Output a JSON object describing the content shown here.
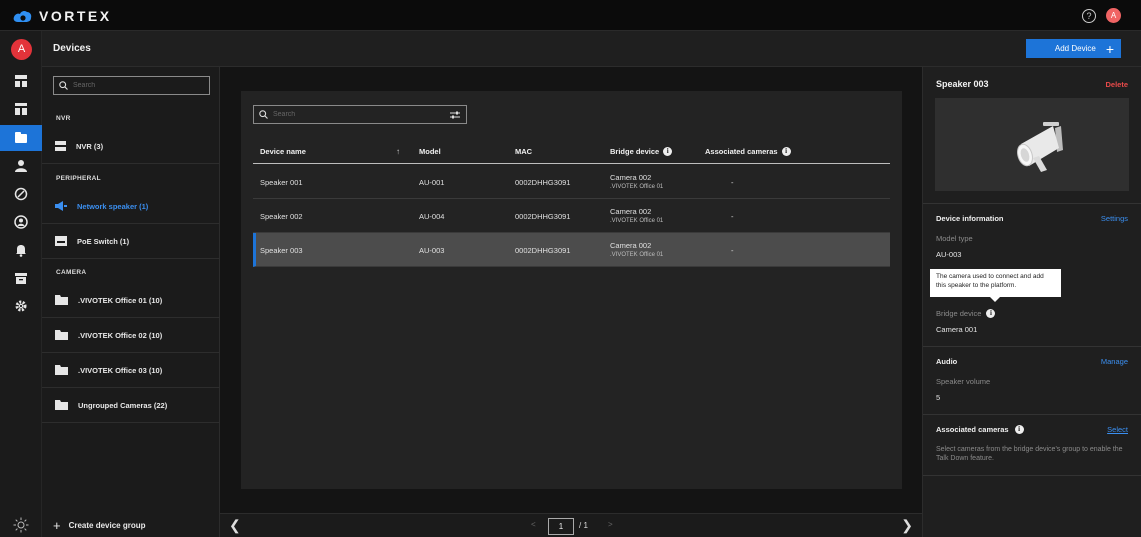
{
  "app": {
    "brand": "VORTEX",
    "user_initial": "A"
  },
  "header": {
    "title": "Devices",
    "add_device_label": "Add Device"
  },
  "left_panel": {
    "search_placeholder": "Search",
    "sections": {
      "nvr": "NVR",
      "peripheral": "PERIPHERAL",
      "camera": "CAMERA"
    },
    "groups": [
      {
        "label": "NVR (3)",
        "icon": "nvr-icon"
      },
      {
        "label": "Network speaker (1)",
        "icon": "speaker-icon",
        "active": true
      },
      {
        "label": "PoE Switch (1)",
        "icon": "poe-switch-icon"
      },
      {
        "label": ".VIVOTEK Office 01 (10)",
        "icon": "folder-icon"
      },
      {
        "label": ".VIVOTEK Office 02 (10)",
        "icon": "folder-icon"
      },
      {
        "label": ".VIVOTEK Office 03 (10)",
        "icon": "folder-icon"
      },
      {
        "label": "Ungrouped Cameras (22)",
        "icon": "folder-icon"
      }
    ],
    "create_group_label": "Create device group"
  },
  "table": {
    "search_placeholder": "Search",
    "columns": [
      "Device name",
      "Model",
      "MAC",
      "Bridge device",
      "Associated cameras"
    ],
    "rows": [
      {
        "name": "Speaker 001",
        "model": "AU-001",
        "mac": "0002DHHG3091",
        "bridge": "Camera 002",
        "bridge_group": ".VIVOTEK Office 01",
        "associated": "-"
      },
      {
        "name": "Speaker 002",
        "model": "AU-004",
        "mac": "0002DHHG3091",
        "bridge": "Camera 002",
        "bridge_group": ".VIVOTEK Office 01",
        "associated": "-"
      },
      {
        "name": "Speaker 003",
        "model": "AU-003",
        "mac": "0002DHHG3091",
        "bridge": "Camera 002",
        "bridge_group": ".VIVOTEK Office 01",
        "associated": "-",
        "selected": true
      }
    ]
  },
  "pagination": {
    "current": "1",
    "total": "/ 1"
  },
  "detail": {
    "title": "Speaker 003",
    "delete_label": "Delete",
    "device_info": {
      "heading": "Device information",
      "settings_label": "Settings",
      "model_type_label": "Model type",
      "model_type_value": "AU-003",
      "tooltip": "The camera used to connect and add this speaker to the platform.",
      "bridge_label": "Bridge device",
      "bridge_value": "Camera 001"
    },
    "audio": {
      "heading": "Audio",
      "manage_label": "Manage",
      "volume_label": "Speaker volume",
      "volume_value": "5"
    },
    "associated": {
      "heading": "Associated cameras",
      "select_label": "Select",
      "description": "Select cameras from the bridge device's group to enable the Talk Down feature."
    }
  },
  "colors": {
    "accent": "#1d74d8",
    "danger": "#e84a4a",
    "avatar": "#e3333a"
  }
}
